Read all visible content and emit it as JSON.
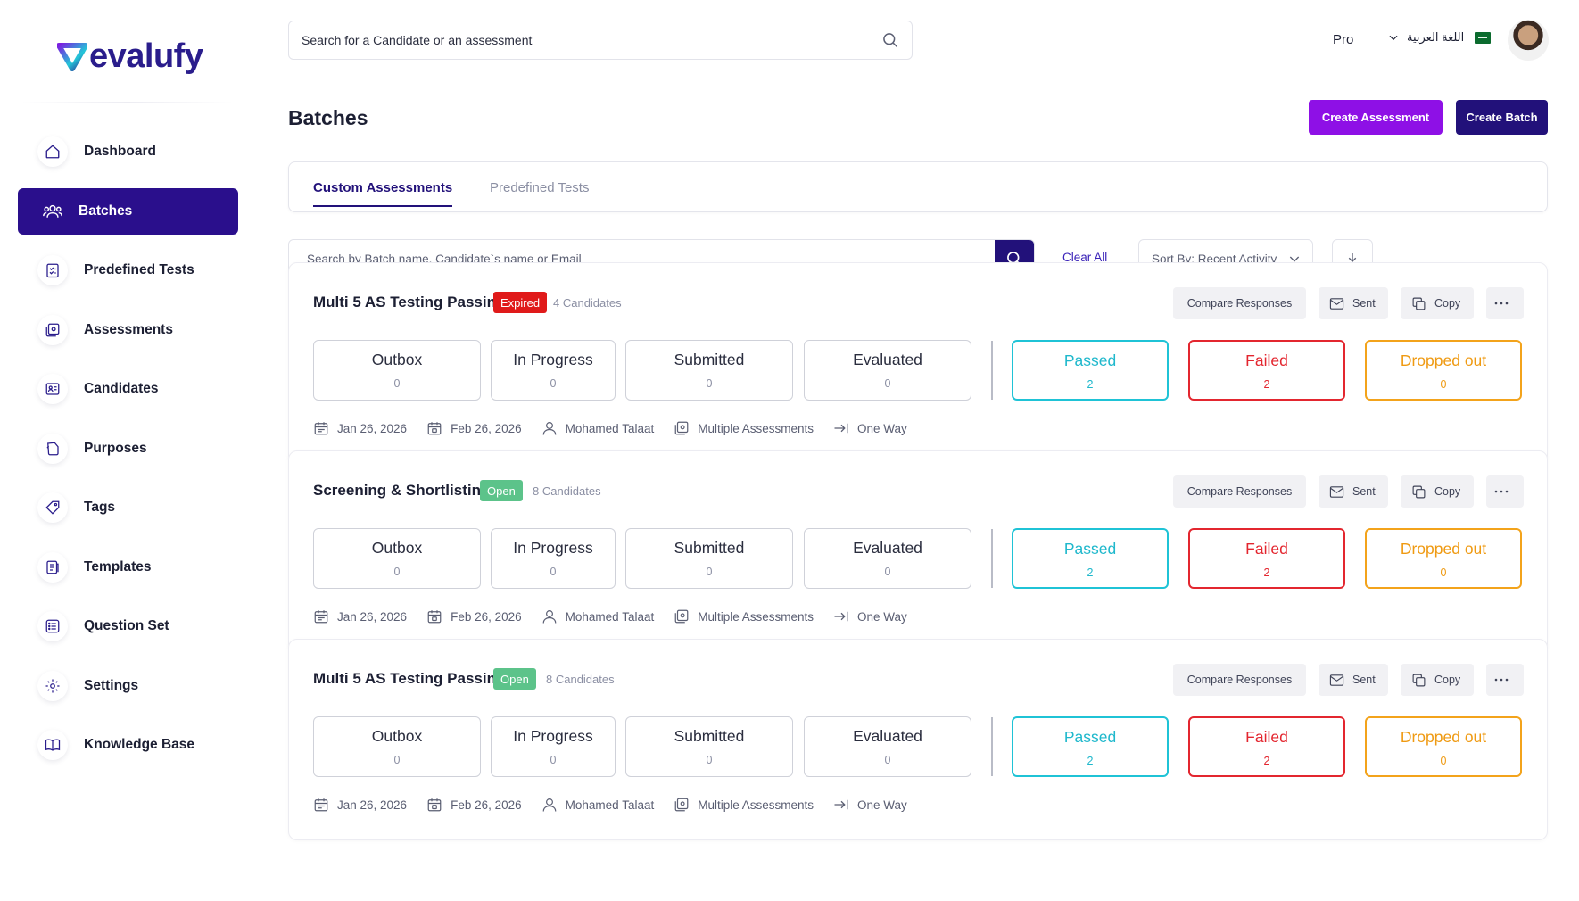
{
  "brand": {
    "logo_text": "evalufy"
  },
  "sidebar": {
    "items": [
      {
        "label": "Dashboard",
        "icon": "home-icon",
        "active": false
      },
      {
        "label": "Batches",
        "icon": "users-icon",
        "active": true
      },
      {
        "label": "Predefined Tests",
        "icon": "checklist-icon",
        "active": false
      },
      {
        "label": "Assessments",
        "icon": "assessment-icon",
        "active": false
      },
      {
        "label": "Candidates",
        "icon": "id-card-icon",
        "active": false
      },
      {
        "label": "Purposes",
        "icon": "purpose-icon",
        "active": false
      },
      {
        "label": "Tags",
        "icon": "tag-icon",
        "active": false
      },
      {
        "label": "Templates",
        "icon": "template-icon",
        "active": false
      },
      {
        "label": "Question Set",
        "icon": "list-icon",
        "active": false
      },
      {
        "label": "Settings",
        "icon": "gear-icon",
        "active": false
      },
      {
        "label": "Knowledge Base",
        "icon": "book-icon",
        "active": false
      }
    ]
  },
  "topbar": {
    "search_placeholder": "Search for a Candidate or an assessment",
    "plan": "Pro",
    "language": "اللغة العربية"
  },
  "page": {
    "title": "Batches",
    "create_assessment": "Create Assessment",
    "create_batch": "Create Batch"
  },
  "tabs": {
    "custom": "Custom Assessments",
    "predefined": "Predefined Tests"
  },
  "filters": {
    "search_placeholder": "Search by Batch name, Candidate`s name or Email",
    "clear_all": "Clear All",
    "sort": "Sort By: Recent Activity"
  },
  "actions": {
    "compare": "Compare Responses",
    "sent": "Sent",
    "copy": "Copy"
  },
  "status_labels": {
    "outbox": "Outbox",
    "in_progress": "In Progress",
    "submitted": "Submitted",
    "evaluated": "Evaluated",
    "passed": "Passed",
    "failed": "Failed",
    "dropped": "Dropped out"
  },
  "batches": [
    {
      "name": "Multi 5 AS Testing Passing",
      "status": "Expired",
      "candidates": "4 Candidates",
      "counts": {
        "outbox": "0",
        "in_progress": "0",
        "submitted": "0",
        "evaluated": "0",
        "passed": "2",
        "failed": "2",
        "dropped": "0"
      },
      "start_date": "Jan 26, 2026",
      "end_date": "Feb 26, 2026",
      "owner": "Mohamed Talaat",
      "type": "Multiple Assessments",
      "mode": "One Way"
    },
    {
      "name": "Screening & Shortlisting",
      "status": "Open",
      "candidates": "8 Candidates",
      "counts": {
        "outbox": "0",
        "in_progress": "0",
        "submitted": "0",
        "evaluated": "0",
        "passed": "2",
        "failed": "2",
        "dropped": "0"
      },
      "start_date": "Jan 26, 2026",
      "end_date": "Feb 26, 2026",
      "owner": "Mohamed Talaat",
      "type": "Multiple Assessments",
      "mode": "One Way"
    },
    {
      "name": "Multi 5 AS Testing Passing",
      "status": "Open",
      "candidates": "8 Candidates",
      "counts": {
        "outbox": "0",
        "in_progress": "0",
        "submitted": "0",
        "evaluated": "0",
        "passed": "2",
        "failed": "2",
        "dropped": "0"
      },
      "start_date": "Jan 26, 2026",
      "end_date": "Feb 26, 2026",
      "owner": "Mohamed Talaat",
      "type": "Multiple Assessments",
      "mode": "One Way"
    }
  ],
  "colors": {
    "primary": "#22117a",
    "accent": "#8e10e6",
    "passed": "#1fc3d6",
    "failed": "#e3262f",
    "dropped": "#f3a31b",
    "open": "#5cc38a",
    "expired": "#e01a1a"
  }
}
